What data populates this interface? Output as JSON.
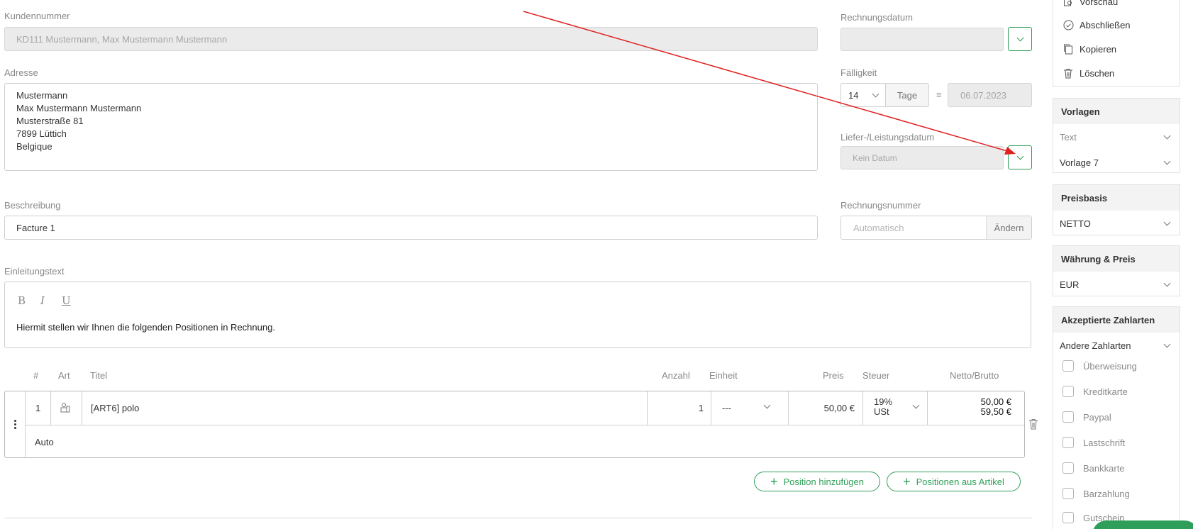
{
  "form": {
    "customer_number": {
      "label": "Kundennummer",
      "value": "KD111 Mustermann, Max Mustermann Mustermann"
    },
    "address": {
      "label": "Adresse",
      "lines": [
        "Mustermann",
        "Max Mustermann Mustermann",
        "Musterstraße 81",
        "7899 Lüttich",
        "Belgique"
      ]
    },
    "description": {
      "label": "Beschreibung",
      "value": "Facture 1"
    },
    "intro": {
      "label": "Einleitungstext",
      "bold": "B",
      "italic": "I",
      "underline": "U",
      "text": "Hiermit stellen wir Ihnen die folgenden Positionen in Rechnung."
    },
    "invoice_date": {
      "label": "Rechnungsdatum",
      "value": ""
    },
    "due": {
      "label": "Fälligkeit",
      "days": "14",
      "unit": "Tage",
      "equals": "=",
      "date": "06.07.2023"
    },
    "delivery_date": {
      "label": "Liefer-/Leistungsdatum",
      "placeholder": "Kein Datum"
    },
    "invoice_number": {
      "label": "Rechnungsnummer",
      "placeholder": "Automatisch",
      "change_label": "Ändern"
    }
  },
  "positions": {
    "headers": {
      "num": "#",
      "type": "Art",
      "title": "Titel",
      "qty": "Anzahl",
      "unit": "Einheit",
      "price": "Preis",
      "tax": "Steuer",
      "net_gross": "Netto/Brutto"
    },
    "rows": [
      {
        "num": "1",
        "title": "[ART6] polo",
        "qty": "1",
        "unit": "---",
        "price": "50,00 €",
        "tax_line1": "19%",
        "tax_line2": "USt",
        "net": "50,00 €",
        "gross": "59,50 €",
        "description": "Auto"
      }
    ],
    "add_position": "Position hinzufügen",
    "add_from_article": "Positionen aus Artikel"
  },
  "sidebar": {
    "actions": [
      {
        "label": "Vorschau",
        "icon": "preview-icon"
      },
      {
        "label": "Abschließen",
        "icon": "check-circle-icon"
      },
      {
        "label": "Kopieren",
        "icon": "copy-icon"
      },
      {
        "label": "Löschen",
        "icon": "trash-icon"
      }
    ],
    "templates": {
      "title": "Vorlagen",
      "text_select": "Text",
      "template_select": "Vorlage 7"
    },
    "price_basis": {
      "title": "Preisbasis",
      "value": "NETTO"
    },
    "currency": {
      "title": "Währung & Preis",
      "value": "EUR"
    },
    "payments": {
      "title": "Akzeptierte Zahlarten",
      "select": "Andere Zahlarten",
      "options": [
        "Überweisung",
        "Kreditkarte",
        "Paypal",
        "Lastschrift",
        "Bankkarte",
        "Barzahlung",
        "Gutschein"
      ]
    }
  },
  "colors": {
    "accent": "#2f9e58",
    "annotation_arrow": "#e02020"
  }
}
